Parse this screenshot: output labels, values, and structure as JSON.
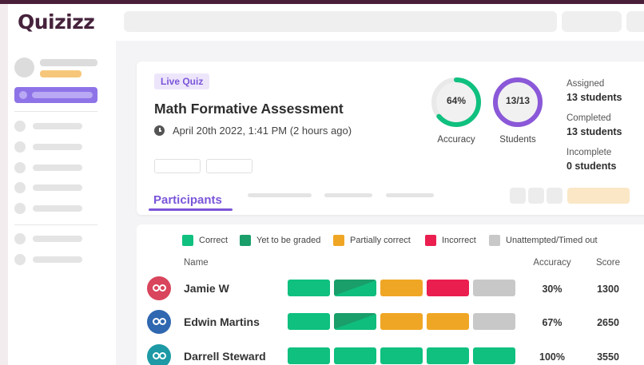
{
  "app": {
    "logo_text": "Quizizz"
  },
  "quiz": {
    "badge": "Live Quiz",
    "title": "Math Formative Assessment",
    "date": "April 20th 2022, 1:41 PM (2 hours ago)"
  },
  "summary": {
    "accuracy": {
      "value": "64%",
      "fraction": 0.64,
      "label": "Accuracy",
      "color": "#0fc07f"
    },
    "students": {
      "value": "13/13",
      "fraction": 1.0,
      "label": "Students",
      "color": "#8a58d8"
    },
    "assigned": {
      "label": "Assigned",
      "value": "13 students"
    },
    "completed": {
      "label": "Completed",
      "value": "13 students"
    },
    "incomplete": {
      "label": "Incomplete",
      "value": "0 students"
    }
  },
  "tabs": {
    "active": "Participants"
  },
  "legend": [
    {
      "label": "Correct",
      "color": "#0fc07f"
    },
    {
      "label": "Yet to be graded",
      "color": "#1a9e6a"
    },
    {
      "label": "Partially correct",
      "color": "#f0a625"
    },
    {
      "label": "Incorrect",
      "color": "#ea1e4f"
    },
    {
      "label": "Unattempted/Timed out",
      "color": "#c8c8c8"
    }
  ],
  "table": {
    "headers": {
      "name": "Name",
      "accuracy": "Accuracy",
      "score": "Score"
    },
    "rows": [
      {
        "name": "Jamie W",
        "accuracy": "30%",
        "score": "1300",
        "avatar_color": "#d8455c",
        "answers": [
          "correct",
          "yet_to_be_graded",
          "partially_correct",
          "incorrect",
          "unattempted"
        ]
      },
      {
        "name": "Edwin Martins",
        "accuracy": "67%",
        "score": "2650",
        "avatar_color": "#2f67b0",
        "answers": [
          "correct",
          "yet_to_be_graded",
          "partially_correct",
          "partially_correct",
          "unattempted"
        ]
      },
      {
        "name": "Darrell Steward",
        "accuracy": "100%",
        "score": "3550",
        "avatar_color": "#1d9aa5",
        "answers": [
          "correct",
          "correct",
          "correct",
          "correct",
          "correct"
        ]
      }
    ]
  }
}
